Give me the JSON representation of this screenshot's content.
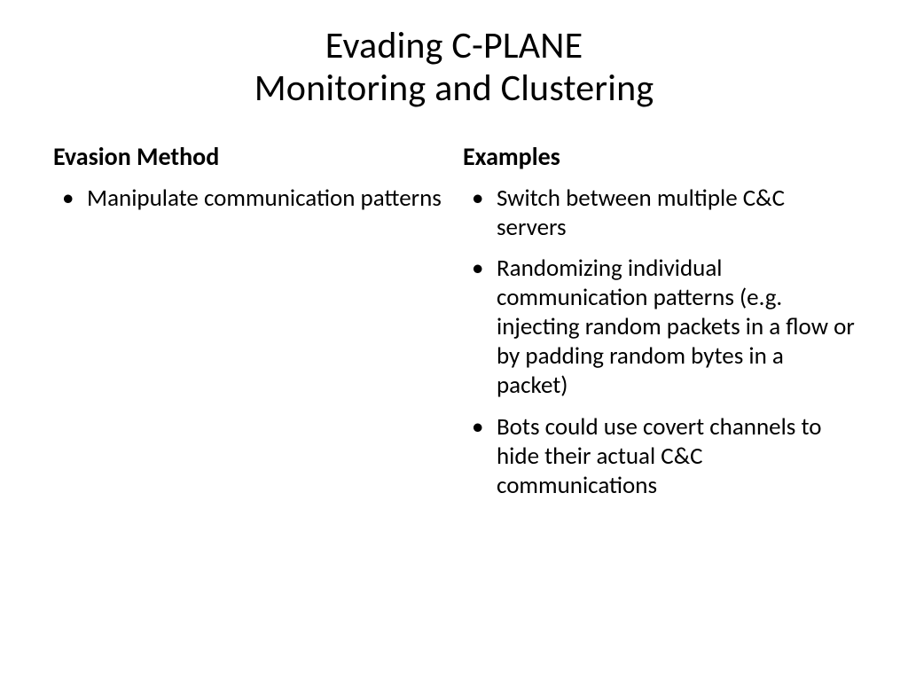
{
  "title_line1": "Evading C-PLANE",
  "title_line2": "Monitoring and Clustering",
  "left": {
    "heading": "Evasion Method",
    "items": [
      "Manipulate communication patterns"
    ]
  },
  "right": {
    "heading": "Examples",
    "items": [
      "Switch between multiple C&C servers",
      "Randomizing individual communication patterns (e.g. injecting random packets in a flow or by padding random bytes in a packet)",
      "Bots could use covert channels to hide their actual C&C communications"
    ]
  }
}
